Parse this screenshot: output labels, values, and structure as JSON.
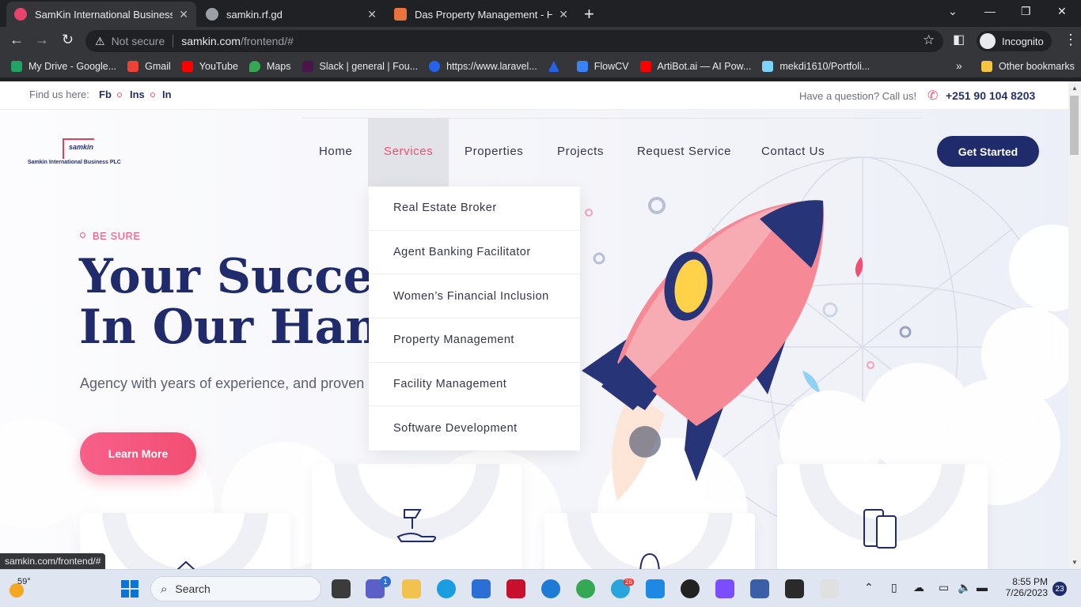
{
  "browser": {
    "tabs": [
      {
        "title": "SamKin International Business PL",
        "color": "#e8436b"
      },
      {
        "title": "samkin.rf.gd",
        "color": "#9aa0a6"
      },
      {
        "title": "Das Property Management - Hom",
        "color": "#e8743b"
      }
    ],
    "omnibox": {
      "security": "Not secure",
      "host": "samkin.com",
      "path": "/frontend/#"
    },
    "profile": "Incognito",
    "bookmarks": [
      {
        "label": "My Drive - Google...",
        "color": "#1fa463"
      },
      {
        "label": "Gmail",
        "color": "#ea4335"
      },
      {
        "label": "YouTube",
        "color": "#ff0000"
      },
      {
        "label": "Maps",
        "color": "#34a853"
      },
      {
        "label": "Slack | general | Fou...",
        "color": "#4a154b"
      },
      {
        "label": "https://www.laravel...",
        "color": "#2563eb"
      },
      {
        "label": "",
        "color": "#2563eb"
      },
      {
        "label": "FlowCV",
        "color": "#3b82f6"
      },
      {
        "label": "ArtiBot.ai — AI Pow...",
        "color": "#ff0000"
      },
      {
        "label": "mekdi1610/Portfoli...",
        "color": "#7dd3fc"
      }
    ],
    "more_bookmarks": "»",
    "other_bookmarks": "Other bookmarks",
    "status_url": "samkin.com/frontend/#"
  },
  "topbar": {
    "find_us": "Find us here:",
    "socials": [
      "Fb",
      "Ins",
      "In"
    ],
    "question": "Have a question? Call us!",
    "phone": "+251 90 104 8203"
  },
  "logo": {
    "word": "samkin",
    "sub": "Samkin International Business PLC"
  },
  "nav": {
    "items": [
      "Home",
      "Services",
      "Properties",
      "Projects",
      "Request Service",
      "Contact Us"
    ],
    "active": "Services",
    "cta": "Get Started"
  },
  "services_menu": [
    "Real Estate Broker",
    "Agent Banking Facilitator",
    "Women’s Financial Inclusion",
    "Property Management",
    "Facility Management",
    "Software Development"
  ],
  "hero": {
    "eyebrow": "BE SURE",
    "title_line1": "Your Success",
    "title_line2": "In Our Hands",
    "tagline": "Agency with years of experience, and proven results",
    "button": "Learn More"
  },
  "taskbar": {
    "weather": "59°",
    "search_placeholder": "Search",
    "time": "8:55 PM",
    "date": "7/26/2023",
    "notifications": "23",
    "badges": {
      "teams": "1",
      "telegram": "26"
    }
  },
  "colors": {
    "brand_navy": "#1f2b6b",
    "accent_pink": "#f24e72"
  }
}
